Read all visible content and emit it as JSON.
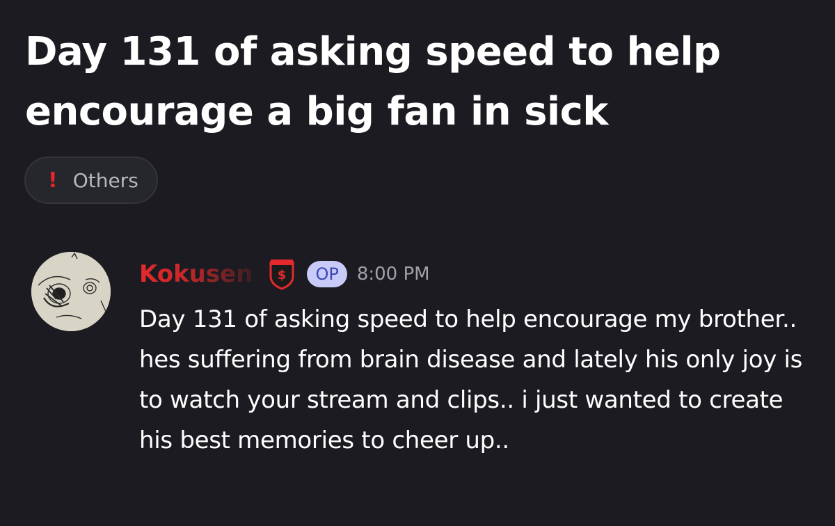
{
  "thread": {
    "title": "Day 131 of asking speed to help encourage a big fan in sick",
    "tag": {
      "icon": "exclamation-icon",
      "icon_glyph": "!",
      "label": "Others"
    }
  },
  "message": {
    "author": "Kokusen",
    "badge_icon": "speed-utd-badge-icon",
    "op_label": "OP",
    "timestamp": "8:00 PM",
    "text": "Day 131  of asking speed to help encourage my brother.. hes suffering from brain disease and lately his only joy is to watch your stream and clips.. i just wanted to create his best memories to cheer up.."
  },
  "colors": {
    "background": "#1c1b21",
    "tag_icon": "#e8262e",
    "username": "#e5292c",
    "op_badge_bg": "#c8cbf7",
    "op_badge_text": "#3e45b5",
    "timestamp": "#a0a1a8"
  }
}
